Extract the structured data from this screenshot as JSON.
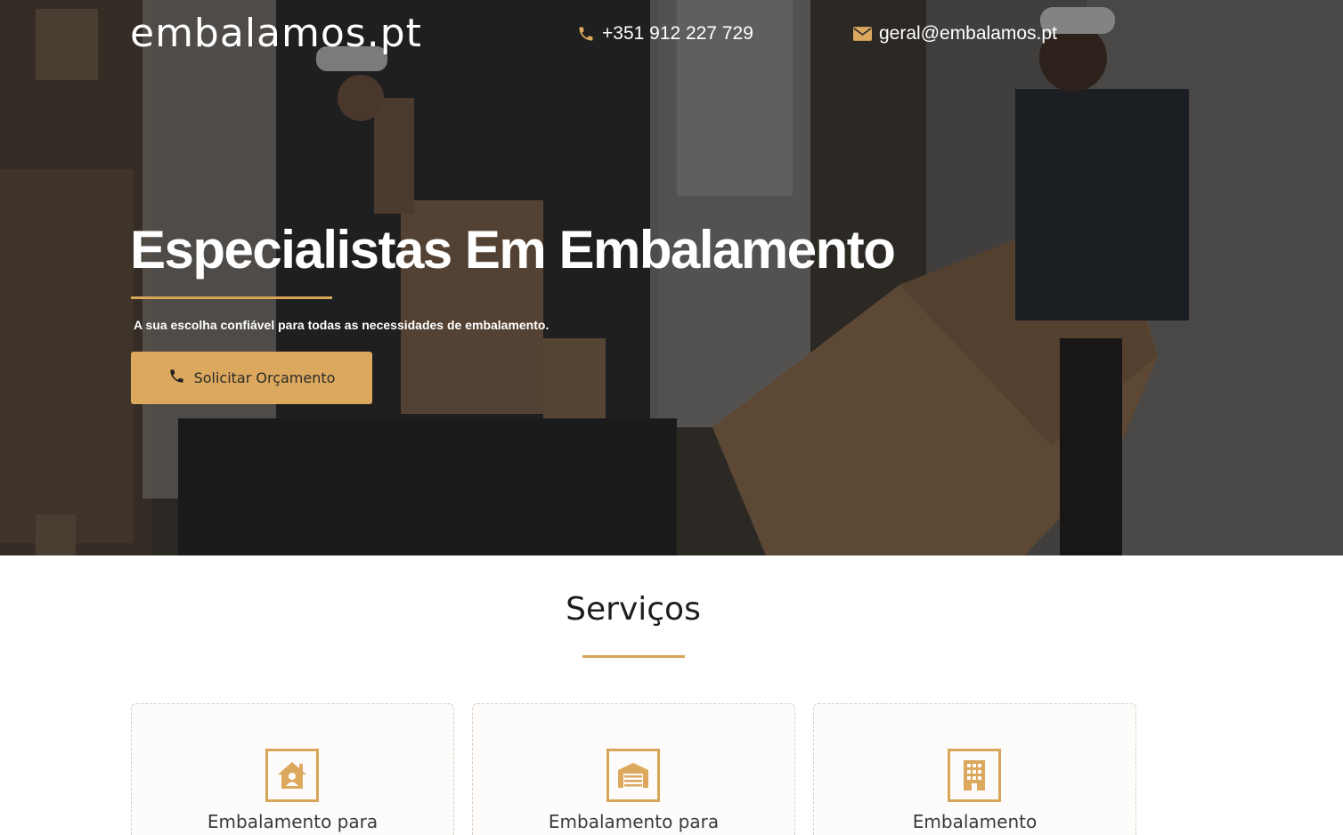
{
  "header": {
    "logo": "embalamos.pt",
    "phone": "+351 912 227 729",
    "email": "geral@embalamos.pt"
  },
  "hero": {
    "title": "Especialistas Em Embalamento",
    "subtitle": "A sua escolha confiável para todas as necessidades de embalamento.",
    "cta_label": "Solicitar Orçamento"
  },
  "services": {
    "title": "Serviços",
    "cards": [
      {
        "title": "Embalamento para",
        "icon": "house-user-icon"
      },
      {
        "title": "Embalamento para",
        "icon": "warehouse-icon"
      },
      {
        "title": "Embalamento",
        "icon": "building-icon"
      }
    ]
  },
  "colors": {
    "accent": "#dca85d",
    "hero_overlay": "#2f2c29",
    "white": "#ffffff"
  }
}
